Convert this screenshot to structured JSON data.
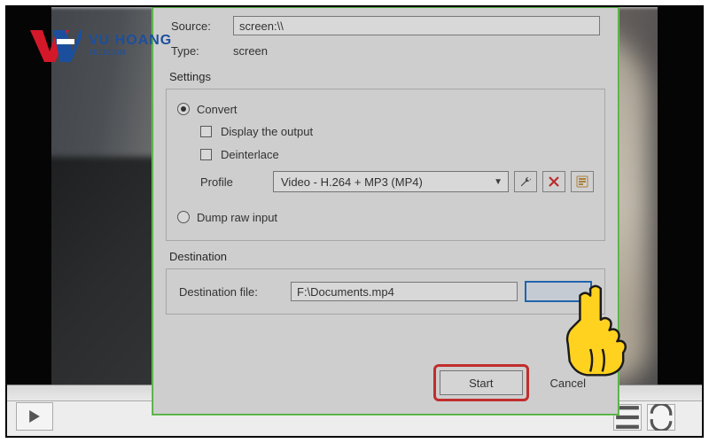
{
  "logo": {
    "brand": "VU HOANG",
    "sub": "TELECOM"
  },
  "source": {
    "source_label": "Source:",
    "source_value": "screen:\\\\",
    "type_label": "Type:",
    "type_value": "screen"
  },
  "settings": {
    "title": "Settings",
    "convert_label": "Convert",
    "display_output_label": "Display the output",
    "deinterlace_label": "Deinterlace",
    "profile_label": "Profile",
    "profile_value": "Video - H.264 + MP3 (MP4)",
    "dump_raw_label": "Dump raw input"
  },
  "destination": {
    "title": "Destination",
    "file_label": "Destination file:",
    "file_value": "F:\\Documents.mp4"
  },
  "footer": {
    "start_label": "Start",
    "cancel_label": "Cancel"
  }
}
